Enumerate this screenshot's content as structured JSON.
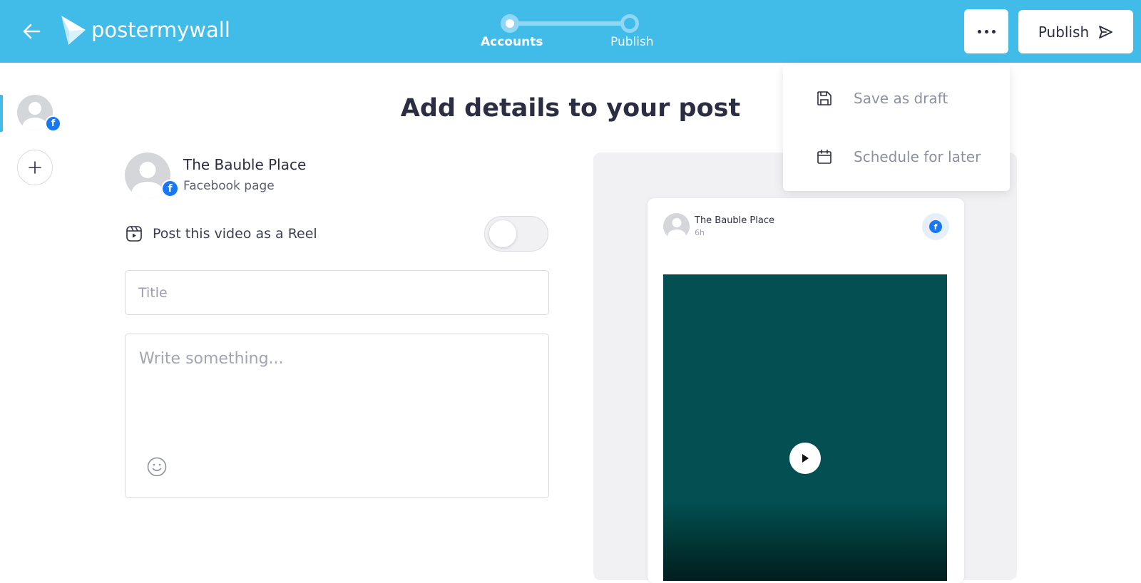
{
  "header": {
    "logo_text": "postermywall",
    "steps": [
      {
        "label": "Accounts"
      },
      {
        "label": "Publish"
      }
    ],
    "publish_label": "Publish",
    "background": "#41bbe8"
  },
  "dropdown": {
    "items": [
      {
        "label": "Save as draft",
        "icon": "floppy-disk-icon"
      },
      {
        "label": "Schedule for later",
        "icon": "calendar-icon"
      }
    ]
  },
  "main": {
    "title": "Add details to your post",
    "account": {
      "name": "The Bauble Place",
      "type": "Facebook page"
    },
    "reel_label": "Post this video as a Reel",
    "reel_enabled": false,
    "title_placeholder": "Title",
    "message_placeholder": "Write something..."
  },
  "preview": {
    "page_name": "The Bauble Place",
    "time": "6h",
    "video_color": "#034f52"
  },
  "colors": {
    "accent": "#41bbe8",
    "facebook": "#1877f2",
    "text": "#2b2d42"
  }
}
